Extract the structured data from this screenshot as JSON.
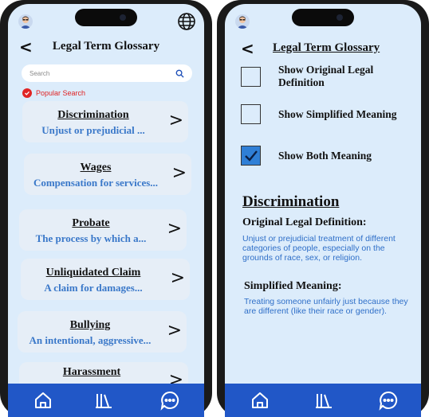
{
  "left_screen": {
    "header": {
      "back_icon": "<",
      "title": "Legal Term Glossary"
    },
    "search": {
      "placeholder": "Search"
    },
    "popular": {
      "label": "Popular Search"
    },
    "terms": [
      {
        "term": "Discrimination",
        "definition": "Unjust or prejudicial ..."
      },
      {
        "term": "Wages",
        "definition": "Compensation for services..."
      },
      {
        "term": "Probate",
        "definition": "The process by which a..."
      },
      {
        "term": "Unliquidated Claim",
        "definition": "A claim for damages..."
      },
      {
        "term": "Bullying",
        "definition": "An intentional, aggressive..."
      },
      {
        "term": "Harassment",
        "definition": ""
      }
    ],
    "arrow": ">"
  },
  "right_screen": {
    "header": {
      "back_icon": "<",
      "title": "Legal Term Glossary"
    },
    "options": [
      {
        "label": "Show Original Legal Definition",
        "checked": false
      },
      {
        "label": "Show Simplified Meaning",
        "checked": false
      },
      {
        "label": "Show Both Meaning",
        "checked": true
      }
    ],
    "detail": {
      "term": "Discrimination",
      "original_heading": "Original Legal Definition:",
      "original_text": "Unjust or prejudicial treatment of different categories of people, especially on the grounds of race, sex, or religion.",
      "simplified_heading": "Simplified Meaning:",
      "simplified_text": "Treating someone unfairly just because they are different (like their race or gender)."
    }
  },
  "tabbar": {
    "icons": [
      "home-icon",
      "library-icon",
      "chat-icon"
    ]
  },
  "colors": {
    "screen_bg": "#dcecfb",
    "tabbar": "#2157c7",
    "link_blue": "#3a78c9",
    "accent_red": "#e02424",
    "checked": "#2f7fd6"
  }
}
